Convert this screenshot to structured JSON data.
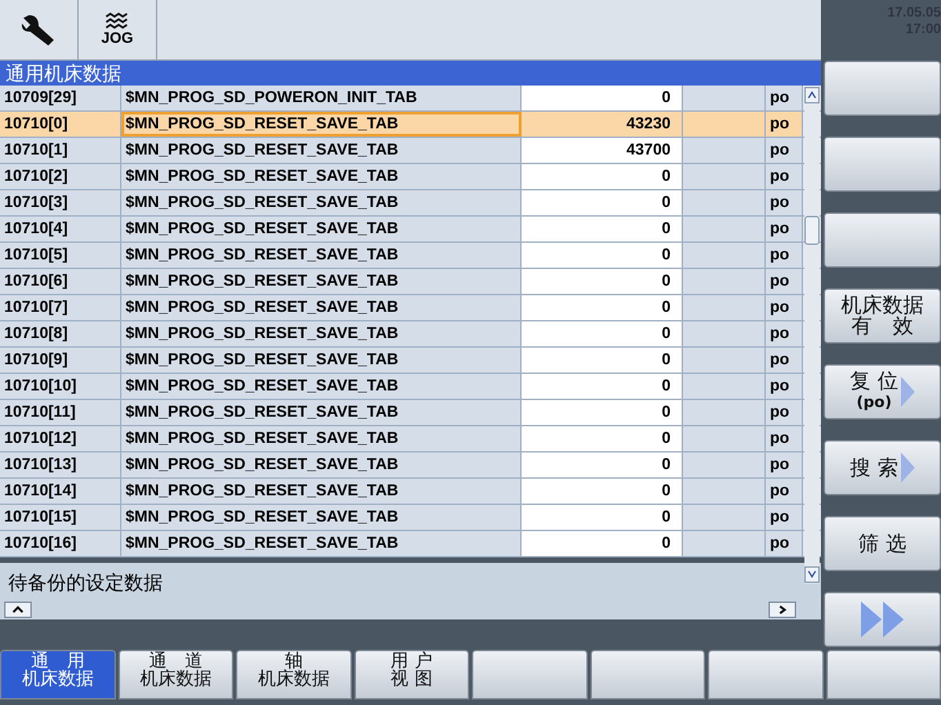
{
  "header": {
    "mode": "JOG",
    "date": "17.05.05",
    "time": "17:00"
  },
  "panel_title": "通用机床数据",
  "table": {
    "rows": [
      {
        "id": "10709[29]",
        "name": "$MN_PROG_SD_POWERON_INIT_TAB",
        "value": "0",
        "unit": "po",
        "selected": false
      },
      {
        "id": "10710[0]",
        "name": "$MN_PROG_SD_RESET_SAVE_TAB",
        "value": "43230",
        "unit": "po",
        "selected": true
      },
      {
        "id": "10710[1]",
        "name": "$MN_PROG_SD_RESET_SAVE_TAB",
        "value": "43700",
        "unit": "po",
        "selected": false
      },
      {
        "id": "10710[2]",
        "name": "$MN_PROG_SD_RESET_SAVE_TAB",
        "value": "0",
        "unit": "po",
        "selected": false
      },
      {
        "id": "10710[3]",
        "name": "$MN_PROG_SD_RESET_SAVE_TAB",
        "value": "0",
        "unit": "po",
        "selected": false
      },
      {
        "id": "10710[4]",
        "name": "$MN_PROG_SD_RESET_SAVE_TAB",
        "value": "0",
        "unit": "po",
        "selected": false
      },
      {
        "id": "10710[5]",
        "name": "$MN_PROG_SD_RESET_SAVE_TAB",
        "value": "0",
        "unit": "po",
        "selected": false
      },
      {
        "id": "10710[6]",
        "name": "$MN_PROG_SD_RESET_SAVE_TAB",
        "value": "0",
        "unit": "po",
        "selected": false
      },
      {
        "id": "10710[7]",
        "name": "$MN_PROG_SD_RESET_SAVE_TAB",
        "value": "0",
        "unit": "po",
        "selected": false
      },
      {
        "id": "10710[8]",
        "name": "$MN_PROG_SD_RESET_SAVE_TAB",
        "value": "0",
        "unit": "po",
        "selected": false
      },
      {
        "id": "10710[9]",
        "name": "$MN_PROG_SD_RESET_SAVE_TAB",
        "value": "0",
        "unit": "po",
        "selected": false
      },
      {
        "id": "10710[10]",
        "name": "$MN_PROG_SD_RESET_SAVE_TAB",
        "value": "0",
        "unit": "po",
        "selected": false
      },
      {
        "id": "10710[11]",
        "name": "$MN_PROG_SD_RESET_SAVE_TAB",
        "value": "0",
        "unit": "po",
        "selected": false
      },
      {
        "id": "10710[12]",
        "name": "$MN_PROG_SD_RESET_SAVE_TAB",
        "value": "0",
        "unit": "po",
        "selected": false
      },
      {
        "id": "10710[13]",
        "name": "$MN_PROG_SD_RESET_SAVE_TAB",
        "value": "0",
        "unit": "po",
        "selected": false
      },
      {
        "id": "10710[14]",
        "name": "$MN_PROG_SD_RESET_SAVE_TAB",
        "value": "0",
        "unit": "po",
        "selected": false
      },
      {
        "id": "10710[15]",
        "name": "$MN_PROG_SD_RESET_SAVE_TAB",
        "value": "0",
        "unit": "po",
        "selected": false
      },
      {
        "id": "10710[16]",
        "name": "$MN_PROG_SD_RESET_SAVE_TAB",
        "value": "0",
        "unit": "po",
        "selected": false
      }
    ]
  },
  "footer_label": "待备份的设定数据",
  "right_softkeys": [
    {
      "kind": "blank"
    },
    {
      "kind": "blank"
    },
    {
      "kind": "blank"
    },
    {
      "lines": [
        "机床数据",
        "有　效"
      ],
      "arrow": false
    },
    {
      "lines": [
        "复 位",
        "(po)"
      ],
      "arrow": true
    },
    {
      "lines": [
        "搜 索"
      ],
      "arrow": true
    },
    {
      "lines": [
        "筛 选"
      ],
      "arrow": false
    },
    {
      "kind": "next"
    }
  ],
  "bottom_softkeys": [
    {
      "lines": [
        "通　用",
        "机床数据"
      ],
      "selected": true
    },
    {
      "lines": [
        "通　道",
        "机床数据"
      ],
      "selected": false
    },
    {
      "lines": [
        "轴",
        "机床数据"
      ],
      "selected": false
    },
    {
      "lines": [
        "用 户",
        "视 图"
      ],
      "selected": false
    },
    {
      "selected": false
    },
    {
      "selected": false
    },
    {
      "selected": false
    },
    {
      "selected": false
    }
  ]
}
